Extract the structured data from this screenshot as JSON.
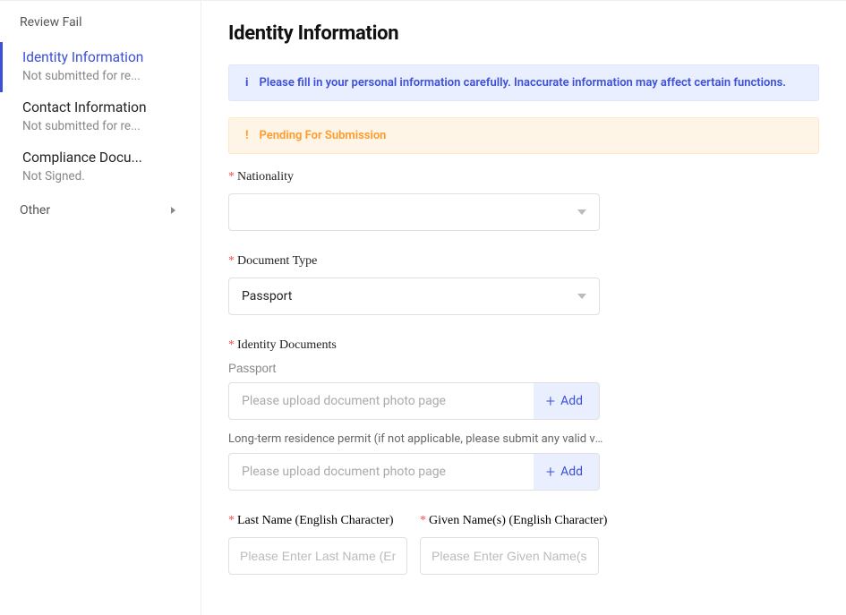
{
  "sidebar": {
    "header": "Review Fail",
    "items": [
      {
        "title": "Identity Information",
        "sub": "Not submitted for re..."
      },
      {
        "title": "Contact Information",
        "sub": "Not submitted for re..."
      },
      {
        "title": "Compliance Docu...",
        "sub": "Not Signed."
      }
    ],
    "other": "Other"
  },
  "page": {
    "title": "Identity Information"
  },
  "alerts": {
    "info": "Please fill in your personal information carefully. Inaccurate information may affect certain functions.",
    "warn": "Pending For Submission"
  },
  "fields": {
    "nationality": {
      "label": "Nationality",
      "value": ""
    },
    "documentType": {
      "label": "Document Type",
      "value": "Passport"
    },
    "identityDocuments": {
      "label": "Identity Documents",
      "passport": {
        "sub": "Passport",
        "placeholder": "Please upload document photo page",
        "button": "Add"
      },
      "permit": {
        "sub": "Long-term residence permit (if not applicable, please submit any valid visa...",
        "placeholder": "Please upload document photo page",
        "button": "Add"
      }
    },
    "lastName": {
      "label": "Last Name (English Character)",
      "placeholder": "Please Enter Last Name (English Character)"
    },
    "givenName": {
      "label": "Given Name(s) (English Character)",
      "placeholder": "Please Enter Given Name(s) (English Character)"
    }
  }
}
